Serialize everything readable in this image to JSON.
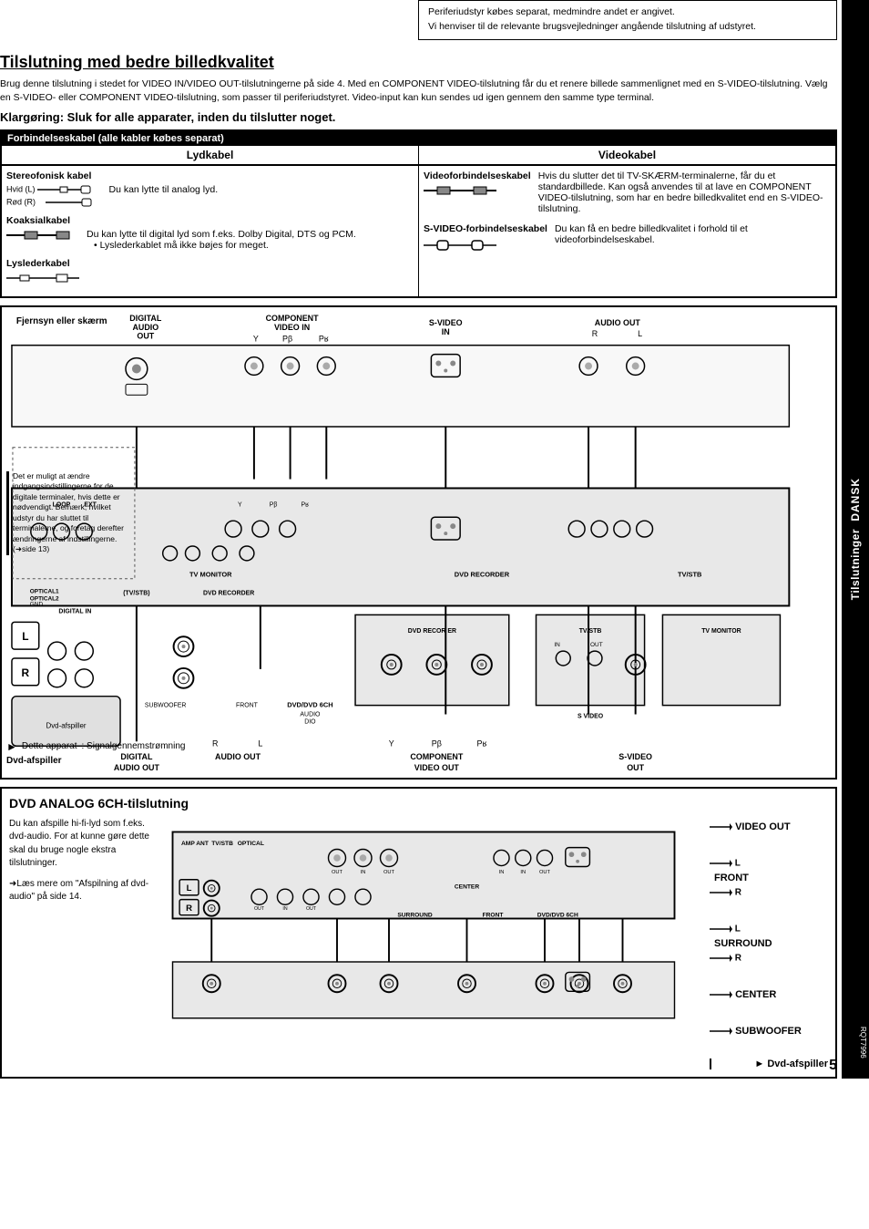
{
  "notice": {
    "line1": "Periferiudstyr købes separat, medmindre andet er angivet.",
    "line2": "Vi henviser til de relevante brugsvejledninger angående tilslutning af udstyret."
  },
  "main_title": "Tilslutning med bedre billedkvalitet",
  "intro_text": "Brug denne tilslutning i stedet for VIDEO IN/VIDEO OUT-tilslutningerne på side 4. Med en COMPONENT VIDEO-tilslutning får du et renere billede sammenlignet med en S-VIDEO-tilslutning. Vælg en S-VIDEO- eller COMPONENT VIDEO-tilslutning, som passer til periferiudstyret. Video-input kan kun sendes ud igen gennem den samme type terminal.",
  "sub_title": "Klargøring: Sluk for alle apparater, inden du tilslutter noget.",
  "cable_table": {
    "title": "Forbindelseskabel (alle kabler købes separat)",
    "left_header": "Lydkabel",
    "right_header": "Videokabel",
    "stereo_title": "Stereofonisk kabel",
    "stereo_colors": [
      "Hvid (L)",
      "Rød (R)"
    ],
    "stereo_desc": "Du kan lytte til analog lyd.",
    "coax_title": "Koaksialkabel",
    "coax_desc": "Du kan lytte til digital lyd som f.eks. Dolby Digital, DTS og PCM.",
    "coax_bullet": "Lyslederkablet må ikke bøjes for meget.",
    "lysleder_title": "Lyslederkabel",
    "video_title": "Videoforbindelseskabel",
    "video_desc_1": "Hvis du slutter det til TV-SKÆRM-terminalerne, får du et standardbillede. Kan også anvendes til at lave en COMPONENT VIDEO-tilslutning, som har en bedre billedkvalitet end en S-VIDEO-tilslutning.",
    "svideo_title": "S-VIDEO-forbindelseskabel",
    "svideo_desc": "Du kan få en bedre billedkvalitet i forhold til et videoforbindelseskabel."
  },
  "side_note": {
    "text": "Det er muligt at ændre indgangsindstillingerne for de digitale terminaler, hvis dette er nødvendigt. Bemærk, hvilket udstyr du har sluttet til terminalerne, og foretag derefter ændringerne af indstillingerne. (➜side 13)"
  },
  "legend": {
    "signal_label": "Dette apparat",
    "arrow_desc": ": Signalgennemstrømning",
    "dvd_label": "Dvd-afspiller"
  },
  "diagram": {
    "tv_label": "Fjernsyn eller skærm",
    "digital_audio_out": "DIGITAL\nAUDIO\nOUT",
    "component_video_in": "COMPONENT\nVIDEO IN",
    "svideo_in": "S-VIDEO\nIN",
    "audio_out_top": "AUDIO OUT",
    "r_label": "R",
    "l_label": "L",
    "y_label": "Y",
    "pb_label": "PB",
    "pr_label": "PR",
    "tv_monitor_label": "TV MONITOR",
    "dvd_recorder_label": "DVD RECORDER",
    "tvstb_label": "TV/STB",
    "component_video_label": "COMPONENT VIDEO",
    "digital_audio_out_bottom": "DIGITAL\nAUDIO OUT",
    "svideo_out": "S-VIDEO\nOUT"
  },
  "dvd_section": {
    "title": "DVD ANALOG 6CH-tilslutning",
    "text_1": "Du kan afspille hi-fi-lyd som f.eks. dvd-audio. For at kunne gøre dette skal du bruge nogle ekstra tilslutninger.",
    "text_2": "➜Læs mere om \"Afspilning af dvd-audio\" på side 14.",
    "video_out": "VIDEO OUT",
    "front_label": "FRONT",
    "r_label": "R",
    "l_label": "L",
    "surround_label": "SURROUND",
    "center_label": "CENTER",
    "subwoofer_label": "SUBWOOFER",
    "dvd_player_label": "Dvd-afspiller"
  },
  "sidebar": {
    "dansk": "DANSK",
    "tilslutninger": "Tilslutninger",
    "page_number": "5",
    "rqt_code": "RQT7996"
  }
}
